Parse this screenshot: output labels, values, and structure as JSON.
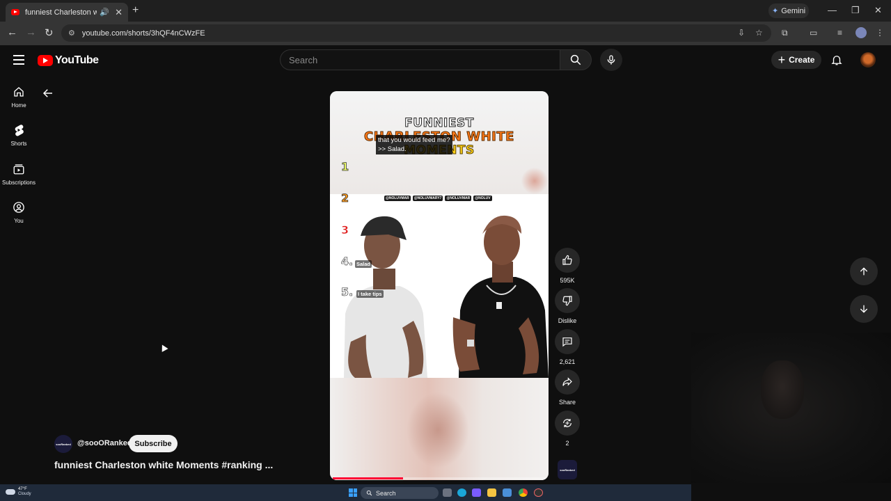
{
  "browser": {
    "tab_title": "funniest Charleston white M",
    "tab_audio_icon": "speaker-icon",
    "url": "youtube.com/shorts/3hQF4nCWzFE",
    "gemini_label": "Gemini"
  },
  "youtube": {
    "logo_text": "YouTube",
    "search_placeholder": "Search",
    "create_label": "Create"
  },
  "sidebar": {
    "items": [
      {
        "label": "Home",
        "icon": "home-icon"
      },
      {
        "label": "Shorts",
        "icon": "shorts-icon"
      },
      {
        "label": "Subscriptions",
        "icon": "subscriptions-icon"
      },
      {
        "label": "You",
        "icon": "you-icon"
      }
    ]
  },
  "video": {
    "title_line1": "FUNNIEST",
    "title_line2": "CHARLESTON WHITE",
    "title_line3": "MOMENTS",
    "caption_line1": "that you would feed me?",
    "caption_line2": ">> Salad.",
    "ranks": [
      "1",
      "2",
      "3",
      "4.",
      "5."
    ],
    "rank4_label": "Salad",
    "rank5_label": "I take tips",
    "handles": [
      "@NOLUVMAR",
      "@NOLUVMARY7",
      "@NOLUVMAR",
      "@NOLUV"
    ],
    "progress_fraction": 0.33
  },
  "actions": {
    "like_count": "595K",
    "dislike_label": "Dislike",
    "comment_count": "2,621",
    "share_label": "Share",
    "remix_count": "2"
  },
  "channel": {
    "handle": "@sooORanked",
    "avatar_text": "sooRanked",
    "subscribe_label": "Subscribe",
    "video_title": "funniest Charleston white Moments #ranking ..."
  },
  "taskbar": {
    "weather_temp": "47°F",
    "weather_desc": "Cloudy",
    "search_label": "Search"
  },
  "colors": {
    "youtube_red": "#ff0000",
    "progress_red": "#ff0033",
    "background": "#0f0f0f"
  }
}
